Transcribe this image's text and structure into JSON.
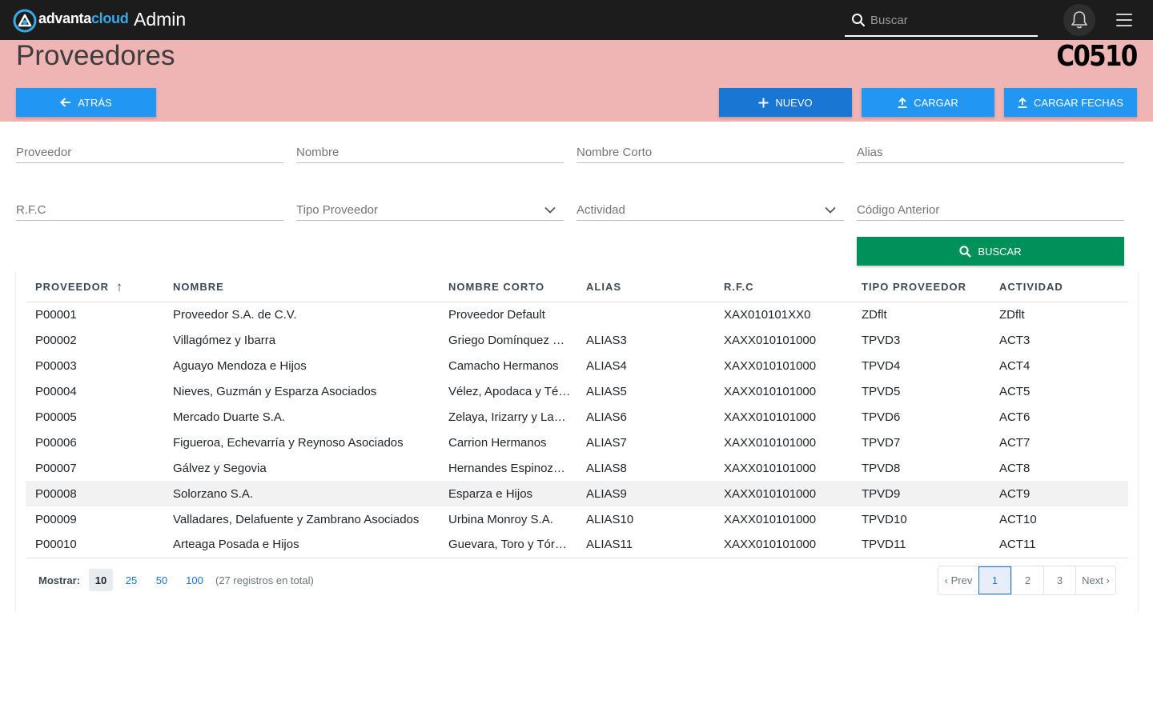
{
  "topbar": {
    "brand_part1": "advanta",
    "brand_part2": "cloud",
    "app_title": "Admin",
    "search_placeholder": "Buscar"
  },
  "header": {
    "title": "Proveedores",
    "company_code": "C0510",
    "back_label": "ATRÁS",
    "new_label": "NUEVO",
    "upload_label": "CARGAR",
    "upload_dates_label": "CARGAR FECHAS"
  },
  "filters": {
    "proveedor": "Proveedor",
    "nombre": "Nombre",
    "nombre_corto": "Nombre Corto",
    "alias": "Alias",
    "rfc": "R.F.C",
    "tipo_proveedor": "Tipo Proveedor",
    "actividad": "Actividad",
    "codigo_anterior": "Código Anterior",
    "search_label": "BUSCAR"
  },
  "table": {
    "headers": [
      "PROVEEDOR",
      "NOMBRE",
      "NOMBRE CORTO",
      "ALIAS",
      "R.F.C",
      "TIPO PROVEEDOR",
      "ACTIVIDAD"
    ],
    "sort_indicator": "↑",
    "rows": [
      [
        "P00001",
        "Proveedor S.A. de C.V.",
        "Proveedor Default",
        "",
        "XAX010101XX0",
        "ZDflt",
        "ZDflt"
      ],
      [
        "P00002",
        "Villagómez y Ibarra",
        "Griego Domínquez …",
        "ALIAS3",
        "XAXX010101000",
        "TPVD3",
        "ACT3"
      ],
      [
        "P00003",
        "Aguayo Mendoza e Hijos",
        "Camacho Hermanos",
        "ALIAS4",
        "XAXX010101000",
        "TPVD4",
        "ACT4"
      ],
      [
        "P00004",
        "Nieves, Guzmán y Esparza Asociados",
        "Vélez, Apodaca y Té…",
        "ALIAS5",
        "XAXX010101000",
        "TPVD5",
        "ACT5"
      ],
      [
        "P00005",
        "Mercado Duarte S.A.",
        "Zelaya, Irizarry y La…",
        "ALIAS6",
        "XAXX010101000",
        "TPVD6",
        "ACT6"
      ],
      [
        "P00006",
        "Figueroa, Echevarría y Reynoso Asociados",
        "Carrion Hermanos",
        "ALIAS7",
        "XAXX010101000",
        "TPVD7",
        "ACT7"
      ],
      [
        "P00007",
        "Gálvez y Segovia",
        "Hernandes Espinoz…",
        "ALIAS8",
        "XAXX010101000",
        "TPVD8",
        "ACT8"
      ],
      [
        "P00008",
        "Solorzano S.A.",
        "Esparza e Hijos",
        "ALIAS9",
        "XAXX010101000",
        "TPVD9",
        "ACT9"
      ],
      [
        "P00009",
        "Valladares, Delafuente y Zambrano Asociados",
        "Urbina Monroy S.A.",
        "ALIAS10",
        "XAXX010101000",
        "TPVD10",
        "ACT10"
      ],
      [
        "P00010",
        "Arteaga Posada e Hijos",
        "Guevara, Toro y Tór…",
        "ALIAS11",
        "XAXX010101000",
        "TPVD11",
        "ACT11"
      ]
    ]
  },
  "footer": {
    "show_label": "Mostrar:",
    "page_sizes": [
      "10",
      "25",
      "50",
      "100"
    ],
    "selected_page_size": "10",
    "total_text": "(27 registros en total)",
    "pager": [
      "‹ Prev",
      "1",
      "2",
      "3",
      "Next ›"
    ],
    "current_page": "1"
  },
  "colors": {
    "topbar_bg": "#1c1c1c",
    "header_band": "#efb4b4",
    "primary": "#2196f3",
    "primary_dark": "#1976d2",
    "search_button": "#00915a",
    "brand_accent": "#38a9e8"
  },
  "icons": [
    "advantacloud-logo-icon",
    "search-icon",
    "bell-icon",
    "hamburger-menu-icon",
    "arrow-left-icon",
    "plus-icon",
    "upload-icon",
    "chevron-down-icon",
    "sort-arrow-up-icon"
  ]
}
